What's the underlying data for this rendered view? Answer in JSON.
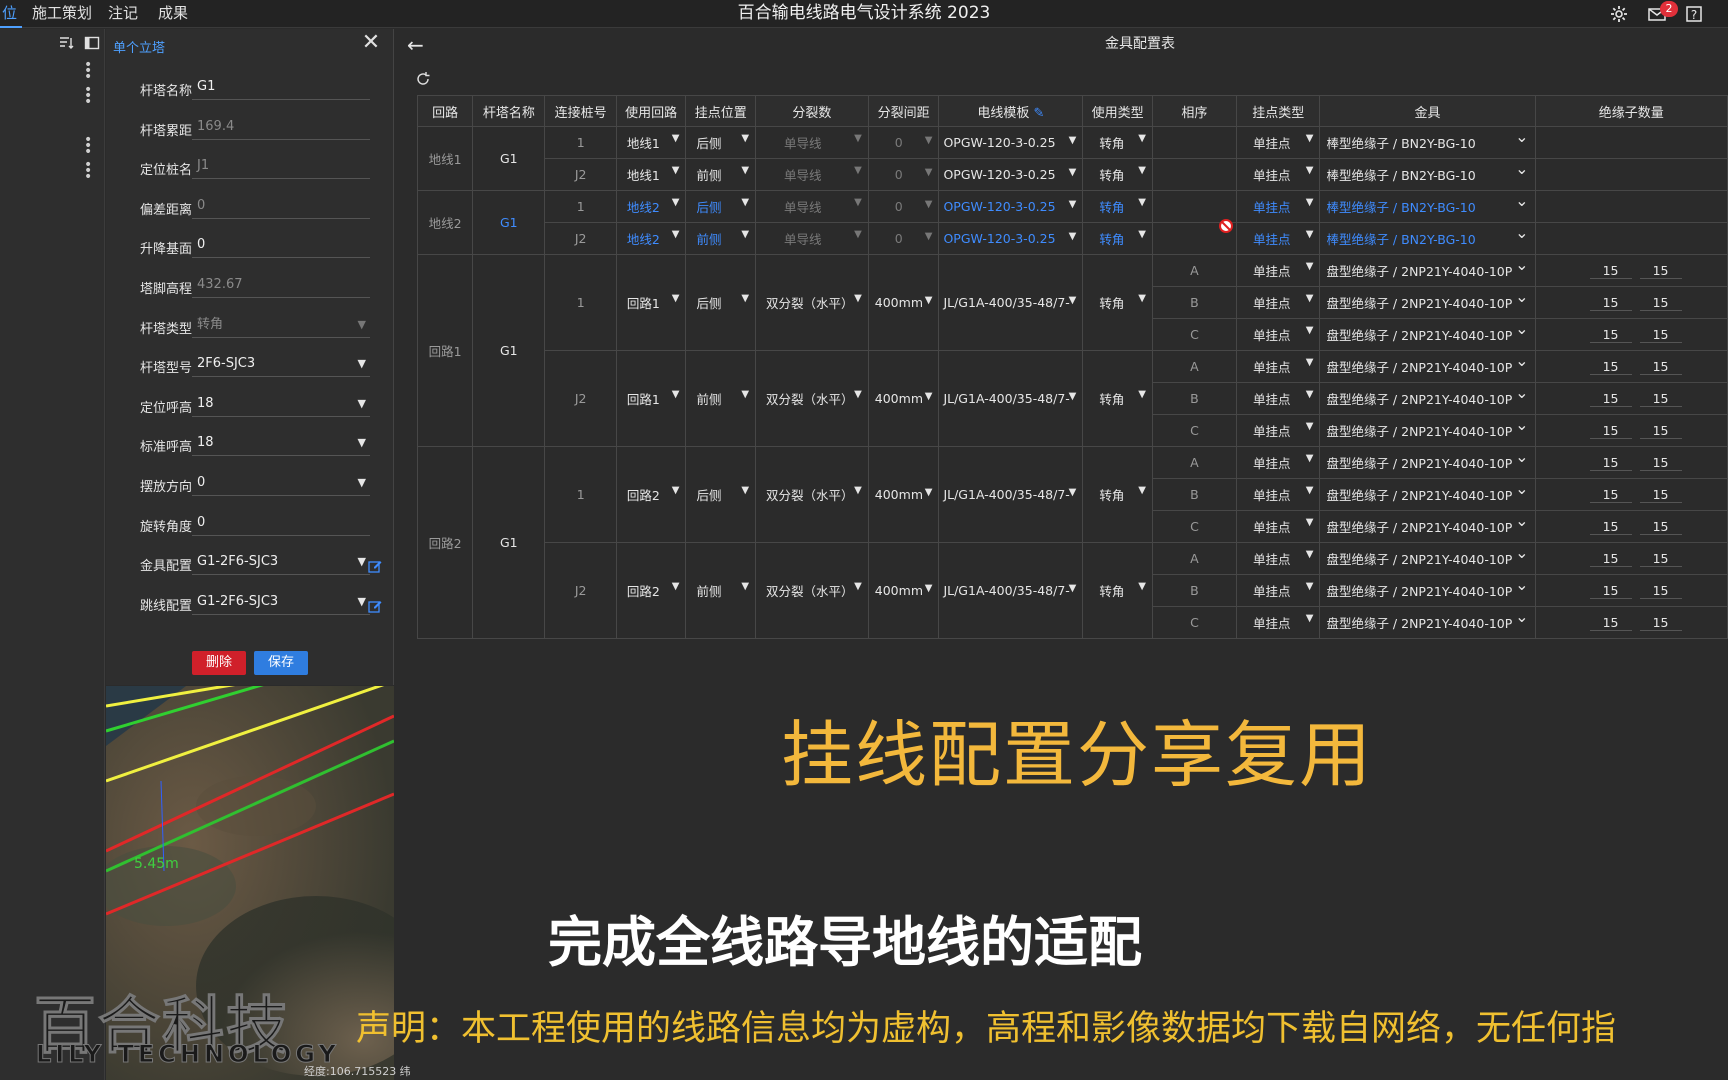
{
  "app_title": "百合输电线路电气设计系统 2023",
  "menu": [
    "位",
    "施工策划",
    "注记",
    "成果"
  ],
  "mail_badge": "2",
  "panel": {
    "title": "单个立塔",
    "fields": [
      {
        "label": "杆塔名称",
        "value": "G1",
        "dim": false,
        "select": false
      },
      {
        "label": "杆塔累距",
        "value": "169.4",
        "dim": true,
        "select": false
      },
      {
        "label": "定位桩名",
        "value": "J1",
        "dim": true,
        "select": false
      },
      {
        "label": "偏差距离",
        "value": "0",
        "dim": true,
        "select": false
      },
      {
        "label": "升降基面",
        "value": "0",
        "dim": false,
        "select": false
      },
      {
        "label": "塔脚高程",
        "value": "432.67",
        "dim": true,
        "select": false
      },
      {
        "label": "杆塔类型",
        "value": "转角",
        "dim": true,
        "select": true
      },
      {
        "label": "杆塔型号",
        "value": "2F6-SJC3",
        "dim": false,
        "select": true
      },
      {
        "label": "定位呼高",
        "value": "18",
        "dim": false,
        "select": true
      },
      {
        "label": "标准呼高",
        "value": "18",
        "dim": false,
        "select": true
      },
      {
        "label": "摆放方向",
        "value": "0",
        "dim": false,
        "select": true
      },
      {
        "label": "旋转角度",
        "value": "0",
        "dim": false,
        "select": false
      },
      {
        "label": "金具配置",
        "value": "G1-2F6-SJC3",
        "dim": false,
        "select": true,
        "edit": true
      },
      {
        "label": "跳线配置",
        "value": "G1-2F6-SJC3",
        "dim": false,
        "select": true,
        "edit": true
      }
    ],
    "delete_label": "删除",
    "save_label": "保存"
  },
  "map_text": "5.45m",
  "coord_text": "经度:106.715523 纬",
  "main_title": "金具配置表",
  "table": {
    "headers": [
      "回路",
      "杆塔名称",
      "连接桩号",
      "使用回路",
      "挂点位置",
      "分裂数",
      "分裂间距",
      "电线模板",
      "使用类型",
      "相序",
      "挂点类型",
      "金具",
      "绝缘子数量"
    ],
    "groups": [
      {
        "loop": "地线1",
        "tower": "G1",
        "blue": false,
        "subs": [
          {
            "pile": "1",
            "use_loop": "地线1",
            "pos": "后侧",
            "split": "单导线",
            "gap": "0",
            "tpl": "OPGW-120-3-0.25",
            "type": "转角",
            "blue": false,
            "phases": [
              {
                "seq": "",
                "hang": "单挂点",
                "fitting": "棒型绝缘子 / BN2Y-BG-10",
                "n1": "",
                "n2": ""
              }
            ]
          },
          {
            "pile": "J2",
            "use_loop": "地线1",
            "pos": "前侧",
            "split": "单导线",
            "gap": "0",
            "tpl": "OPGW-120-3-0.25",
            "type": "转角",
            "blue": false,
            "phases": [
              {
                "seq": "",
                "hang": "单挂点",
                "fitting": "棒型绝缘子 / BN2Y-BG-10",
                "n1": "",
                "n2": ""
              }
            ]
          }
        ]
      },
      {
        "loop": "地线2",
        "tower": "G1",
        "blue": true,
        "subs": [
          {
            "pile": "1",
            "use_loop": "地线2",
            "pos": "后侧",
            "split": "单导线",
            "gap": "0",
            "tpl": "OPGW-120-3-0.25",
            "type": "转角",
            "blue": true,
            "phases": [
              {
                "seq": "",
                "hang": "单挂点",
                "fitting": "棒型绝缘子 / BN2Y-BG-10",
                "n1": "",
                "n2": ""
              }
            ]
          },
          {
            "pile": "J2",
            "use_loop": "地线2",
            "pos": "前侧",
            "split": "单导线",
            "gap": "0",
            "tpl": "OPGW-120-3-0.25",
            "type": "转角",
            "blue": true,
            "phases": [
              {
                "seq": "",
                "hang": "单挂点",
                "fitting": "棒型绝缘子 / BN2Y-BG-10",
                "n1": "",
                "n2": ""
              }
            ]
          }
        ]
      },
      {
        "loop": "回路1",
        "tower": "G1",
        "blue": false,
        "subs": [
          {
            "pile": "1",
            "use_loop": "回路1",
            "pos": "后侧",
            "split": "双分裂（水平）",
            "gap": "400mm",
            "tpl": "JL/G1A-400/35-48/7-",
            "type": "转角",
            "blue": false,
            "phases": [
              {
                "seq": "A",
                "hang": "单挂点",
                "fitting": "盘型绝缘子 / 2NP21Y-4040-10P",
                "n1": "15",
                "n2": "15"
              },
              {
                "seq": "B",
                "hang": "单挂点",
                "fitting": "盘型绝缘子 / 2NP21Y-4040-10P",
                "n1": "15",
                "n2": "15"
              },
              {
                "seq": "C",
                "hang": "单挂点",
                "fitting": "盘型绝缘子 / 2NP21Y-4040-10P",
                "n1": "15",
                "n2": "15"
              }
            ]
          },
          {
            "pile": "J2",
            "use_loop": "回路1",
            "pos": "前侧",
            "split": "双分裂（水平）",
            "gap": "400mm",
            "tpl": "JL/G1A-400/35-48/7-",
            "type": "转角",
            "blue": false,
            "phases": [
              {
                "seq": "A",
                "hang": "单挂点",
                "fitting": "盘型绝缘子 / 2NP21Y-4040-10P",
                "n1": "15",
                "n2": "15"
              },
              {
                "seq": "B",
                "hang": "单挂点",
                "fitting": "盘型绝缘子 / 2NP21Y-4040-10P",
                "n1": "15",
                "n2": "15"
              },
              {
                "seq": "C",
                "hang": "单挂点",
                "fitting": "盘型绝缘子 / 2NP21Y-4040-10P",
                "n1": "15",
                "n2": "15"
              }
            ]
          }
        ]
      },
      {
        "loop": "回路2",
        "tower": "G1",
        "blue": false,
        "subs": [
          {
            "pile": "1",
            "use_loop": "回路2",
            "pos": "后侧",
            "split": "双分裂（水平）",
            "gap": "400mm",
            "tpl": "JL/G1A-400/35-48/7-",
            "type": "转角",
            "blue": false,
            "phases": [
              {
                "seq": "A",
                "hang": "单挂点",
                "fitting": "盘型绝缘子 / 2NP21Y-4040-10P",
                "n1": "15",
                "n2": "15"
              },
              {
                "seq": "B",
                "hang": "单挂点",
                "fitting": "盘型绝缘子 / 2NP21Y-4040-10P",
                "n1": "15",
                "n2": "15"
              },
              {
                "seq": "C",
                "hang": "单挂点",
                "fitting": "盘型绝缘子 / 2NP21Y-4040-10P",
                "n1": "15",
                "n2": "15"
              }
            ]
          },
          {
            "pile": "J2",
            "use_loop": "回路2",
            "pos": "前侧",
            "split": "双分裂（水平）",
            "gap": "400mm",
            "tpl": "JL/G1A-400/35-48/7-",
            "type": "转角",
            "blue": false,
            "phases": [
              {
                "seq": "A",
                "hang": "单挂点",
                "fitting": "盘型绝缘子 / 2NP21Y-4040-10P",
                "n1": "15",
                "n2": "15"
              },
              {
                "seq": "B",
                "hang": "单挂点",
                "fitting": "盘型绝缘子 / 2NP21Y-4040-10P",
                "n1": "15",
                "n2": "15"
              },
              {
                "seq": "C",
                "hang": "单挂点",
                "fitting": "盘型绝缘子 / 2NP21Y-4040-10P",
                "n1": "15",
                "n2": "15"
              }
            ]
          }
        ]
      }
    ]
  },
  "overlay": {
    "slogan1": "挂线配置分享复用",
    "slogan2": "完成全线路导地线的适配",
    "disclaimer": "声明：本工程使用的线路信息均为虚构，高程和影像数据均下载自网络，无任何指",
    "logo_cn": "百合科技",
    "logo_en": "LILY TECHNOLOGY"
  },
  "colors": {
    "accent": "#4ea0ff",
    "highlight_blue": "#3f8cff",
    "delete_red": "#d0202a",
    "save_blue": "#2f7de0",
    "slogan_orange": "#f3b83c",
    "disclaimer_yellow": "#f0c030"
  }
}
